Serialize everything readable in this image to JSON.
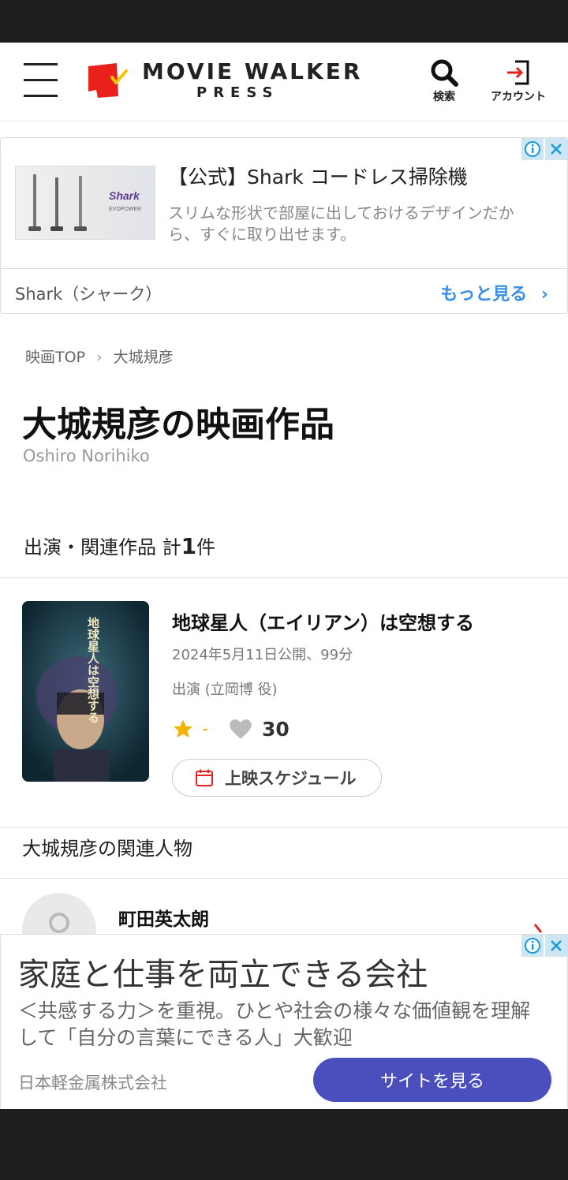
{
  "header": {
    "logo_line1": "MOVIE WALKER",
    "logo_line2": "PRESS",
    "search_label": "検索",
    "account_label": "アカウント"
  },
  "ad_top": {
    "title": "【公式】Shark コードレス掃除機",
    "description": "スリムな形状で部屋に出しておけるデザインだから、すぐに取り出せます。",
    "image_brand": "Shark",
    "image_sub": "EVOPOWER",
    "brand": "Shark（シャーク）",
    "more_label": "もっと見る"
  },
  "breadcrumb": {
    "home": "映画TOP",
    "current": "大城規彦"
  },
  "person": {
    "title": "大城規彦の映画作品",
    "romaji": "Oshiro Norihiko"
  },
  "works": {
    "label": "出演・関連作品 計",
    "count": "1",
    "unit": "件"
  },
  "film": {
    "title": "地球星人（エイリアン）は空想する",
    "meta": "2024年5月11日公開、99分",
    "role": "出演 (立岡博 役)",
    "rating": "-",
    "likes": "30",
    "schedule_label": "上映スケジュール",
    "poster_text": "地球星人は空想する"
  },
  "related": {
    "heading": "大城規彦の関連人物",
    "people": [
      {
        "name": "町田英太朗"
      }
    ]
  },
  "ad_bottom": {
    "title": "家庭と仕事を両立できる会社",
    "description": "＜共感する力＞を重視。ひとや社会の様々な価値観を理解して「自分の言葉にできる人」大歓迎",
    "brand": "日本軽金属株式会社",
    "cta": "サイトを見る"
  },
  "colors": {
    "brand_red": "#e8211c",
    "brand_yellow": "#f5c400",
    "link_blue": "#3a8ee6",
    "cta_purple": "#4a4fbd",
    "star_yellow": "#f3b300"
  }
}
